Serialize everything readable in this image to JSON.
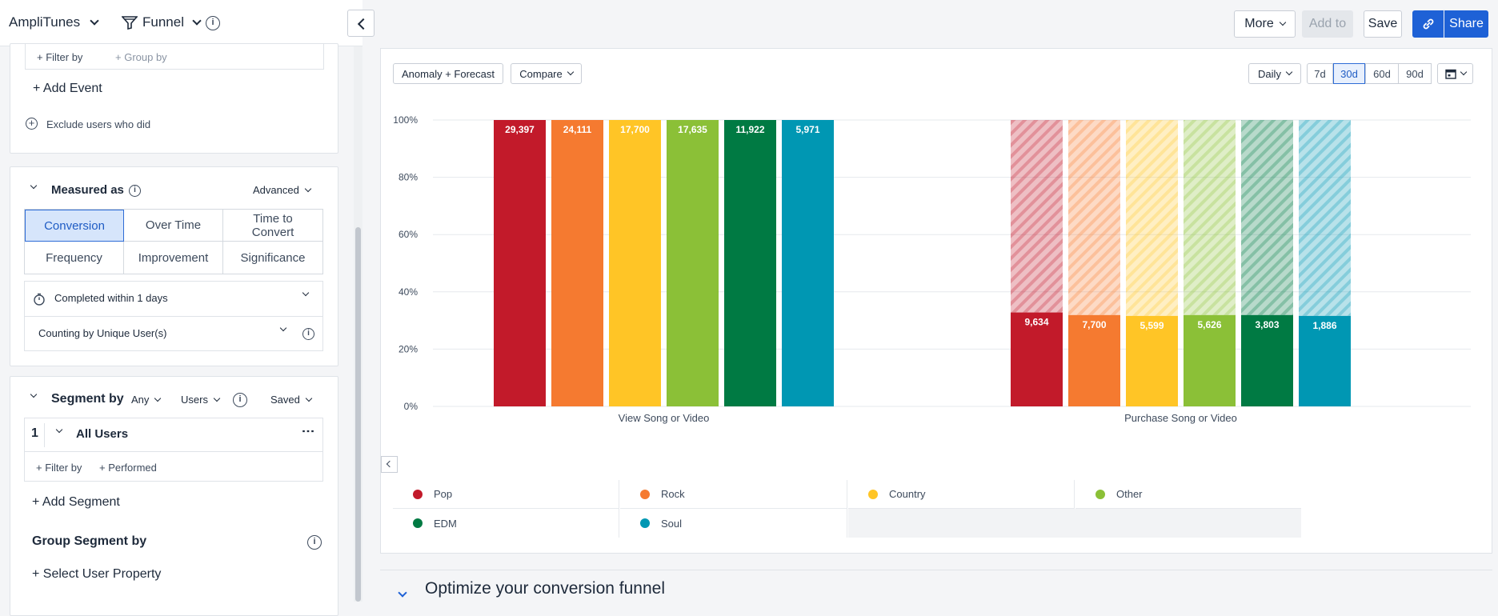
{
  "topbar": {
    "project": "AmpliTunes",
    "chart_type": "Funnel",
    "more": "More",
    "add_to": "Add to",
    "save": "Save",
    "share": "Share"
  },
  "sidebar": {
    "filter_by": "+ Filter by",
    "group_by": "+ Group by",
    "add_event": "+ Add Event",
    "exclude": "Exclude users who did",
    "measured_as": "Measured as",
    "advanced": "Advanced",
    "metrics": [
      "Conversion",
      "Over Time",
      "Time to Convert",
      "Frequency",
      "Improvement",
      "Significance"
    ],
    "completed_within": "Completed within 1 days",
    "counting_by": "Counting by Unique User(s)",
    "segment_by": "Segment by",
    "any": "Any",
    "users": "Users",
    "saved": "Saved",
    "segment_number": "1",
    "segment_name": "All Users",
    "seg_filter_by": "+ Filter by",
    "seg_performed": "+ Performed",
    "add_segment": "+ Add Segment",
    "group_segment_by": "Group Segment by",
    "select_user_property": "+ Select User Property"
  },
  "panel": {
    "anomaly": "Anomaly + Forecast",
    "compare": "Compare",
    "interval": "Daily",
    "ranges": [
      "7d",
      "30d",
      "60d",
      "90d"
    ],
    "active_range": "30d"
  },
  "chart_data": {
    "type": "bar",
    "categories": [
      "View Song or Video",
      "Purchase Song or Video"
    ],
    "ylim": [
      0,
      100
    ],
    "yticks": [
      "0%",
      "20%",
      "40%",
      "60%",
      "80%",
      "100%"
    ],
    "series": [
      {
        "name": "Pop",
        "color": "#c21a2a",
        "values": [
          100,
          32.8
        ],
        "labels": [
          "29,397",
          "9,634"
        ]
      },
      {
        "name": "Rock",
        "color": "#f57a30",
        "values": [
          100,
          31.9
        ],
        "labels": [
          "24,111",
          "7,700"
        ]
      },
      {
        "name": "Country",
        "color": "#ffc526",
        "values": [
          100,
          31.6
        ],
        "labels": [
          "17,700",
          "5,599"
        ]
      },
      {
        "name": "Other",
        "color": "#8bc037",
        "values": [
          100,
          31.9
        ],
        "labels": [
          "17,635",
          "5,626"
        ]
      },
      {
        "name": "EDM",
        "color": "#007a43",
        "values": [
          100,
          31.9
        ],
        "labels": [
          "11,922",
          "3,803"
        ]
      },
      {
        "name": "Soul",
        "color": "#0097b3",
        "values": [
          100,
          31.6
        ],
        "labels": [
          "5,971",
          "1,886"
        ]
      }
    ]
  },
  "optimize": "Optimize your conversion funnel"
}
